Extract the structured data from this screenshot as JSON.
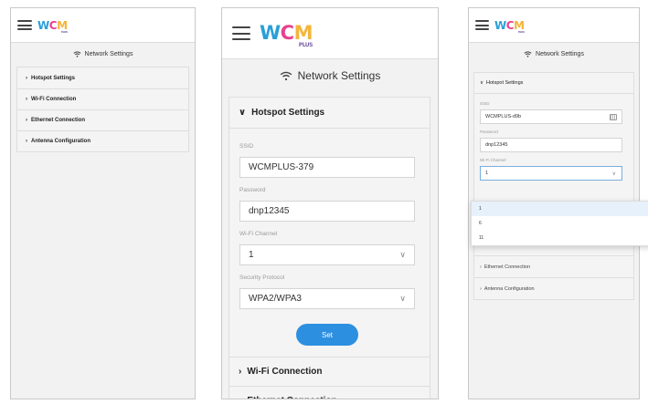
{
  "logo": {
    "w": "W",
    "c": "C",
    "m": "M",
    "plus": "PLUS"
  },
  "header": {
    "title": "Network Settings",
    "icon": "wifi-icon"
  },
  "sections": {
    "hotspot": "Hotspot Settings",
    "wifi": "Wi-Fi Connection",
    "ethernet": "Ethernet Connection",
    "antenna": "Antenna Configuration"
  },
  "hotspot_form": {
    "ssid_label": "SSID",
    "ssid_value": "WCMPLUS-379",
    "password_label": "Password",
    "password_value": "dnp12345",
    "channel_label": "Wi-Fi Channel",
    "channel_value": "1",
    "security_label": "Security Protocol",
    "security_value": "WPA2/WPA3",
    "set_button": "Set"
  },
  "phone3_form": {
    "ssid_value": "WCMPLUS-d9b",
    "password_value": "dnp12345",
    "channel_value": "1",
    "channel_options": [
      "1",
      "6",
      "11"
    ]
  },
  "colors": {
    "accent": "#2d8fe0",
    "logo_w": "#2a9fd8",
    "logo_c": "#e8418f",
    "logo_m": "#f4b53a"
  }
}
